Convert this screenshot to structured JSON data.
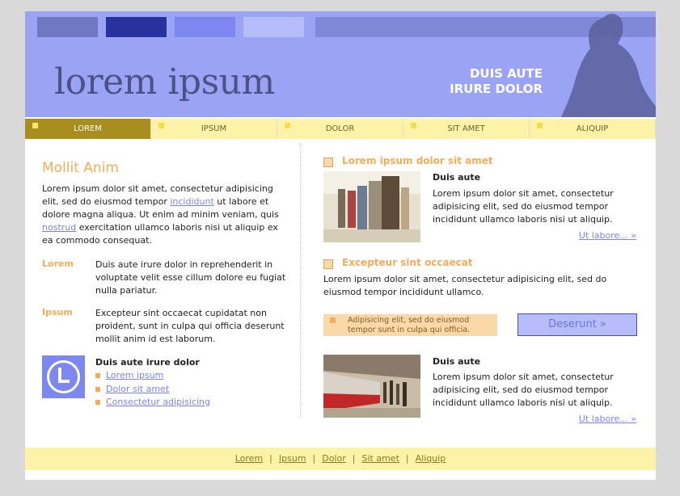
{
  "header": {
    "logo": "lorem ipsum",
    "tagline_line1": "DUIS AUTE",
    "tagline_line2": "IRURE DOLOR"
  },
  "nav": {
    "items": [
      "LOREM",
      "IPSUM",
      "DOLOR",
      "SIT AMET",
      "ALIQUIP"
    ]
  },
  "left": {
    "title": "Mollit Anim",
    "intro_part1": "Lorem ipsum dolor sit amet, consectetur adipisicing elit, sed do eiusmod tempor",
    "intro_link1": "incididunt",
    "intro_part2": "ut labore et dolore magna aliqua. Ut enim ad minim veniam, quis",
    "intro_link2": "nostrud",
    "intro_part3": "exercitation ullamco laboris nisi ut aliquip ex ea commodo consequat.",
    "def1_term": "Lorem",
    "def1_text": "Duis aute irure dolor in reprehenderit in voluptate velit esse cillum dolore eu fugiat nulla pariatur.",
    "def2_term": "Ipsum",
    "def2_text": "Excepteur sint occaecat cupidatat non proident, sunt in culpa qui officia deserunt mollit anim id est laborum.",
    "box_title": "Duis aute irure dolor",
    "box_links": [
      "Lorem ipsum",
      "Dolor sit amet",
      "Consectetur adipisicing"
    ]
  },
  "right": {
    "section1_title": "Lorem ipsum dolor sit amet",
    "item1_title": "Duis aute",
    "item1_text": "Lorem ipsum dolor sit amet, consectetur adipisicing elit, sed do eiusmod tempor incididunt ullamco laboris nisi ut aliquip.",
    "item1_more": "Ut labore... »",
    "section2_title": "Excepteur sint occaecat",
    "section2_text": "Lorem ipsum dolor sit amet, consectetur adipisicing elit, sed do eiusmod tempor incididunt ullamco.",
    "note_text": "Adipisicing elit, sed do eiusmod tempor sunt in culpa qui officia.",
    "button_label": "Deserunt »",
    "item2_title": "Duis aute",
    "item2_text": "Lorem ipsum dolor sit amet, consectetur adipisicing elit, sed do eiusmod tempor incididunt ullamco laboris nisi ut aliquip.",
    "item2_more": "Ut labore... »"
  },
  "footer": {
    "links": [
      "Lorem",
      "Ipsum",
      "Dolor",
      "Sit amet",
      "Aliquip"
    ],
    "separator": "|"
  },
  "colors": {
    "header_bg": "#9ba3f5",
    "nav_bg": "#fdf3a8",
    "nav_active": "#a98d1f",
    "accent_orange": "#f2ac5a",
    "link_blue": "#7b84f2"
  }
}
